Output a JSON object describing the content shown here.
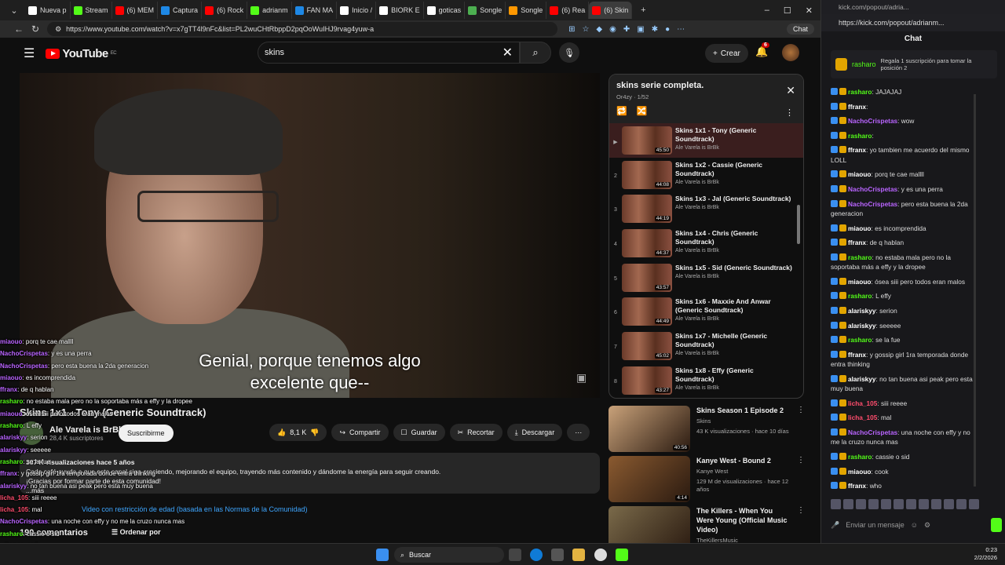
{
  "browser": {
    "tabs": [
      {
        "label": "Nueva p",
        "color": "#ffffff"
      },
      {
        "label": "Stream",
        "color": "#53fc18"
      },
      {
        "label": "(6) MEM",
        "color": "#ff0000"
      },
      {
        "label": "Captura",
        "color": "#1e88e5"
      },
      {
        "label": "(6) Rock",
        "color": "#ff0000"
      },
      {
        "label": "adrianm",
        "color": "#53fc18"
      },
      {
        "label": "FAN MA",
        "color": "#1e88e5"
      },
      {
        "label": "Inicio /",
        "color": "#ffffff"
      },
      {
        "label": "BIORK E",
        "color": "#ffffff"
      },
      {
        "label": "goticas",
        "color": "#ffffff"
      },
      {
        "label": "Songle",
        "color": "#4caf50"
      },
      {
        "label": "Songle",
        "color": "#ff9800"
      },
      {
        "label": "(6) Rea",
        "color": "#ff0000"
      },
      {
        "label": "(6) Skin",
        "color": "#ff0000"
      }
    ],
    "url": "https://www.youtube.com/watch?v=x7gTT4l9nFc&list=PL2wuCHtRbppD2pqOoWuIHJ9rvag4yuw-a",
    "chat_button": "Chat"
  },
  "youtube": {
    "logo": "YouTube",
    "logo_region": "EC",
    "search_value": "skins",
    "create_label": "Crear",
    "notif_count": "6",
    "video": {
      "subtitle_line1": "Genial, porque tenemos algo",
      "subtitle_line2": "excelente que--",
      "title": "Skins 1x1 - Tony (Generic Soundtrack)",
      "channel": "Ale Varela is BrBk",
      "subscribers": "28,4 K suscriptores",
      "subscribe_label": "Suscribirme",
      "likes": "8,1 K",
      "share": "Compartir",
      "save": "Guardar",
      "clip": "Recortar",
      "download": "Descargar",
      "desc_meta": "387 K visualizaciones  hace 5 años",
      "desc_line1": "Cada café ayuda a que este canal siga creciendo, mejorando el equipo, trayendo más contenido y dándome la energía para seguir creando.",
      "desc_line2": "¡Gracias por formar parte de esta comunidad!",
      "desc_more": "...más",
      "restriction": "Video con restricción de edad (basada en las Normas de la Comunidad)",
      "comments": "190 comentarios",
      "sort": "Ordenar por"
    },
    "playlist": {
      "title": "skins serie completa.",
      "sub": "Or4zy · 1/52",
      "items": [
        {
          "idx": "▶",
          "title": "Skins 1x1 - Tony (Generic Soundtrack)",
          "channel": "Ale Varela is BrBk",
          "dur": "45:50"
        },
        {
          "idx": "2",
          "title": "Skins 1x2 - Cassie (Generic Soundtrack)",
          "channel": "Ale Varela is BrBk",
          "dur": "44:08"
        },
        {
          "idx": "3",
          "title": "Skins 1x3 - Jal (Generic Soundtrack)",
          "channel": "Ale Varela is BrBk",
          "dur": "44:19"
        },
        {
          "idx": "4",
          "title": "Skins 1x4 - Chris (Generic Soundtrack)",
          "channel": "Ale Varela is BrBk",
          "dur": "44:37"
        },
        {
          "idx": "5",
          "title": "Skins 1x5 - Sid (Generic Soundtrack)",
          "channel": "Ale Varela is BrBk",
          "dur": "43:57"
        },
        {
          "idx": "6",
          "title": "Skins 1x6 - Maxxie And Anwar (Generic Soundtrack)",
          "channel": "Ale Varela is BrBk",
          "dur": "44:49"
        },
        {
          "idx": "7",
          "title": "Skins 1x7 - Michelle (Generic Soundtrack)",
          "channel": "Ale Varela is BrBk",
          "dur": "45:02"
        },
        {
          "idx": "8",
          "title": "Skins 1x8 - Effy (Generic Soundtrack)",
          "channel": "Ale Varela is BrBk",
          "dur": "43:27"
        }
      ]
    },
    "recommendations": [
      {
        "title": "Skins Season 1 Episode 2",
        "channel": "Skins",
        "meta": "43 K visualizaciones · hace 10 días",
        "dur": "40:56",
        "color": "#c9a27a"
      },
      {
        "title": "Kanye West - Bound 2",
        "channel": "Kanye West",
        "meta": "129 M de visualizaciones · hace 12 años",
        "dur": "4:14",
        "color": "#8a5a30"
      },
      {
        "title": "The Killers - When You Were Young (Official Music Video)",
        "channel": "TheKillersMusic",
        "meta": "",
        "dur": "",
        "color": "#7a6a4a"
      }
    ]
  },
  "overlay_chat": [
    {
      "user": "miaouo",
      "text": "porq te cae mallll",
      "style": "w"
    },
    {
      "user": "NachoCrispetas",
      "text": "y es una perra",
      "style": "b"
    },
    {
      "user": "NachoCrispetas",
      "text": "pero esta buena la 2da generacion",
      "style": "b"
    },
    {
      "user": "miaouo",
      "text": "es incomprendida",
      "style": "w"
    },
    {
      "user": "ffranx",
      "text": "de q hablan",
      "style": "w"
    },
    {
      "user": "rasharo",
      "text": "no estaba mala pero no la soportaba más a effy y la dropee",
      "style": "g"
    },
    {
      "user": "miaouo",
      "text": "ósea siii pero todos eran malos",
      "style": "w"
    },
    {
      "user": "rasharo",
      "text": "L effy",
      "style": "g"
    },
    {
      "user": "alariskyy",
      "text": "serion",
      "style": "w"
    },
    {
      "user": "alariskyy",
      "text": "seeeee",
      "style": "w"
    },
    {
      "user": "rasharo",
      "text": "se la fue",
      "style": "g"
    },
    {
      "user": "ffranx",
      "text": "y gossip girl 1ra temporada donde entra thinking",
      "style": "w"
    },
    {
      "user": "alariskyy",
      "text": "no tan buena asi peak pero esta muy buena",
      "style": "w"
    },
    {
      "user": "licha_105",
      "text": "siii reeee",
      "style": "p"
    },
    {
      "user": "licha_105",
      "text": "mal",
      "style": "p"
    },
    {
      "user": "NachoCrispetas",
      "text": "una noche con effy y no me la cruzo nunca mas",
      "style": "b"
    },
    {
      "user": "rasharo",
      "text": "cassie o sid",
      "style": "g"
    },
    {
      "user": "miaouo",
      "text": "cook",
      "style": "w"
    },
    {
      "user": "ffranx",
      "text": "who",
      "style": "w"
    }
  ],
  "kick": {
    "window_title": "kick.com/popout/adria...",
    "url": "https://kick.com/popout/adrianm...",
    "header": "Chat",
    "pinned_user": "rasharo",
    "pinned_gift": "Regala 1 suscripción para tomar la posición 2",
    "messages": [
      {
        "user": "rasharo",
        "text": "JAJAJAJ",
        "style": ""
      },
      {
        "user": "ffranx",
        "text": "",
        "style": "w"
      },
      {
        "user": "NachoCrispetas",
        "text": "wow",
        "style": "b"
      },
      {
        "user": "rasharo",
        "text": "",
        "style": ""
      },
      {
        "user": "ffranx",
        "text": "yo tambien me acuerdo del mismo LOLL",
        "style": "w"
      },
      {
        "user": "miaouo",
        "text": "porq te cae mallll",
        "style": "w"
      },
      {
        "user": "NachoCrispetas",
        "text": "y es una perra",
        "style": "b"
      },
      {
        "user": "NachoCrispetas",
        "text": "pero esta buena la 2da generacion",
        "style": "b"
      },
      {
        "user": "miaouo",
        "text": "es incomprendida",
        "style": "w"
      },
      {
        "user": "ffranx",
        "text": "de q hablan",
        "style": "w"
      },
      {
        "user": "rasharo",
        "text": "no estaba mala pero no la soportaba más a effy y la dropee",
        "style": ""
      },
      {
        "user": "miaouo",
        "text": "ósea siii pero todos eran malos",
        "style": "w"
      },
      {
        "user": "rasharo",
        "text": "L effy",
        "style": ""
      },
      {
        "user": "alariskyy",
        "text": "serion",
        "style": "w"
      },
      {
        "user": "alariskyy",
        "text": "seeeee",
        "style": "w"
      },
      {
        "user": "rasharo",
        "text": "se la fue",
        "style": ""
      },
      {
        "user": "ffranx",
        "text": "y gossip girl 1ra temporada donde entra thinking",
        "style": "w"
      },
      {
        "user": "alariskyy",
        "text": "no tan buena asi peak pero esta muy buena",
        "style": "w"
      },
      {
        "user": "licha_105",
        "text": "siii reeee",
        "style": "r"
      },
      {
        "user": "licha_105",
        "text": "mal",
        "style": "r"
      },
      {
        "user": "NachoCrispetas",
        "text": "una noche con effy y no me la cruzo nunca mas",
        "style": "b"
      },
      {
        "user": "rasharo",
        "text": "cassie o sid",
        "style": ""
      },
      {
        "user": "miaouo",
        "text": "cook",
        "style": "w"
      },
      {
        "user": "ffranx",
        "text": "who",
        "style": "w"
      }
    ],
    "send_placeholder": "Enviar un mensaje"
  },
  "taskbar": {
    "search": "Buscar",
    "time": "0:23",
    "date": "2/2/2026"
  }
}
